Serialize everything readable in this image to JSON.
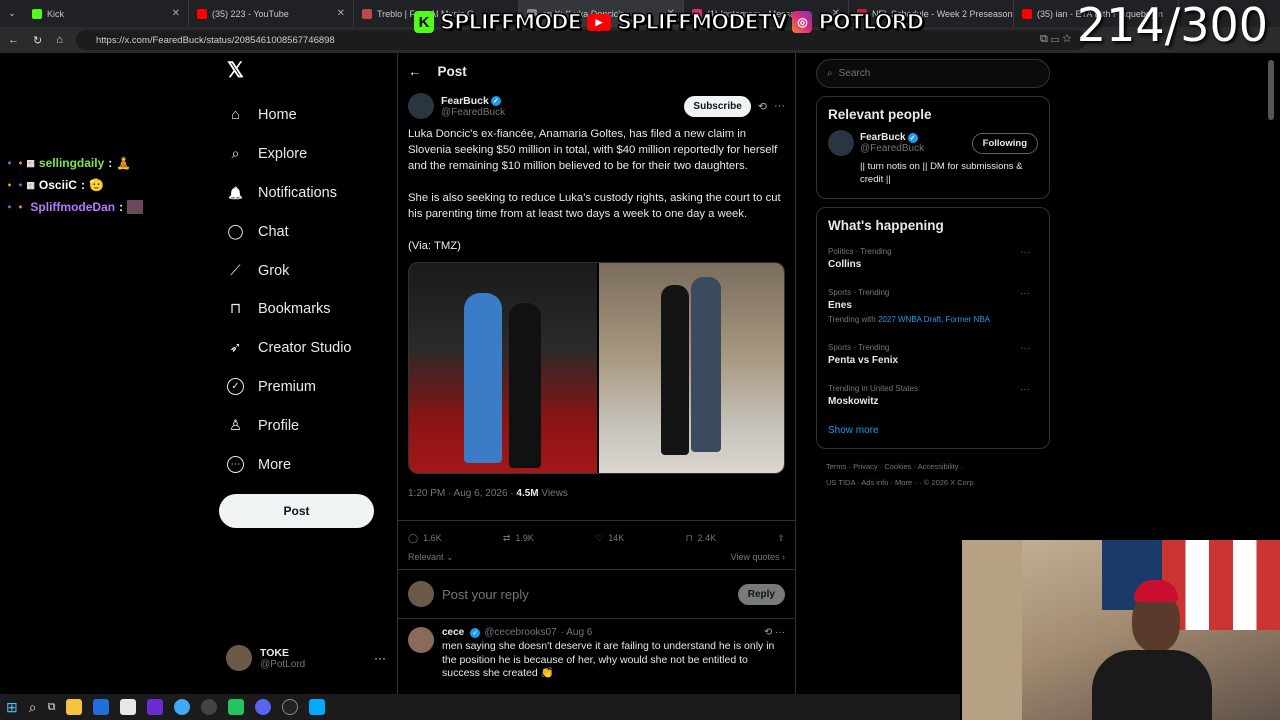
{
  "browser": {
    "tabs": [
      {
        "title": "Kick",
        "color": "#53fc18"
      },
      {
        "title": "(35) 223 - YouTube",
        "color": "#ff0000"
      },
      {
        "title": "Treblo | Free AI Music G",
        "color": "#c04848"
      },
      {
        "title": "on X: \"Luka Doncic's",
        "color": "#888888"
      },
      {
        "title": "(1) Instagram • Messages",
        "color": "#d62976"
      },
      {
        "title": "NFL Schedule - Week 2 Preseason",
        "color": "#c41e3a"
      },
      {
        "title": "(35) ian - ETA with Plaquebeym",
        "color": "#ff0000"
      }
    ],
    "url": "https://x.com/FearedBuck/status/2085461008567746898"
  },
  "stream_overlay": {
    "brands": [
      "SPLIFFMODE",
      "SPLIFFMODETV",
      "POTLORD"
    ],
    "counter": "214/300",
    "chat": [
      {
        "user": "sellingdaily",
        "color": "#7ee64f",
        "emoji": "🧘"
      },
      {
        "user": "OsciiC",
        "color": "#ffffff",
        "emoji": "🫡"
      },
      {
        "user": "SpliffmodeDan",
        "color": "#b27bff",
        "emoji": "▦"
      }
    ]
  },
  "nav": {
    "logo": "𝕏",
    "items": [
      {
        "label": "Home",
        "icon": "⌂"
      },
      {
        "label": "Explore",
        "icon": "⌕"
      },
      {
        "label": "Notifications",
        "icon": "🔔"
      },
      {
        "label": "Chat",
        "icon": "◯"
      },
      {
        "label": "Grok",
        "icon": "⟋"
      },
      {
        "label": "Bookmarks",
        "icon": "⊓"
      },
      {
        "label": "Creator Studio",
        "icon": "➶"
      },
      {
        "label": "Premium",
        "icon": "✓"
      },
      {
        "label": "Profile",
        "icon": "♙"
      },
      {
        "label": "More",
        "icon": "⋯"
      }
    ],
    "post_label": "Post",
    "account": {
      "name": "TOKE",
      "handle": "@PotLord"
    }
  },
  "post": {
    "header": "Post",
    "author": "FearBuck",
    "handle": "@FearedBuck",
    "subscribe": "Subscribe",
    "text1": "Luka Doncic's ex-fiancée, Anamaria Goltes, has filed a new claim in Slovenia seeking $50 million in total, with $40 million reportedly for herself and the remaining $10 million believed to be for their two daughters.",
    "text2": "She is also seeking to reduce Luka's custody rights, asking the court to cut his parenting time from at least two days a week to one day a week.",
    "text3": "(Via: TMZ)",
    "timestamp": "1:20 PM · Aug 6, 2026 ·",
    "views": "4.5M",
    "views_label": "Views",
    "stats": {
      "replies": "1.6K",
      "reposts": "1.9K",
      "likes": "14K",
      "bookmarks": "2.4K"
    },
    "relevant": "Relevant",
    "view_quotes": "View quotes",
    "reply_placeholder": "Post your reply",
    "reply_btn": "Reply"
  },
  "reply": {
    "name": "cece",
    "handle": "@cecebrooks07",
    "time": "· Aug 6",
    "text": "men saying she doesn't deserve it are failing to understand he is only in the position he is because of her, why would she not be entitled to success she created 👏"
  },
  "sidebar": {
    "search_placeholder": "Search",
    "relevant_title": "Relevant people",
    "person": {
      "name": "FearBuck",
      "handle": "@FearedBuck",
      "follow": "Following",
      "bio": "|| turn notis on || DM for submissions & credit ||"
    },
    "happening_title": "What's happening",
    "trends": [
      {
        "category": "Politics · Trending",
        "name": "Collins",
        "sub": ""
      },
      {
        "category": "Sports · Trending",
        "name": "Enes",
        "sub_prefix": "Trending with",
        "sub": "2027 WNBA Draft, Former NBA"
      },
      {
        "category": "Sports · Trending",
        "name": "Penta vs Fenix",
        "sub": ""
      },
      {
        "category": "Trending in United States",
        "name": "Moskowitz",
        "sub": ""
      }
    ],
    "show_more": "Show more",
    "footer1": "Terms · Privacy · Cookies · Accessibility ·",
    "footer2": "US TIDA · Ads info · More ··· © 2026 X Corp."
  },
  "colors": {
    "accent": "#1d9bf0",
    "bg": "#000000",
    "border": "#2f3336"
  }
}
